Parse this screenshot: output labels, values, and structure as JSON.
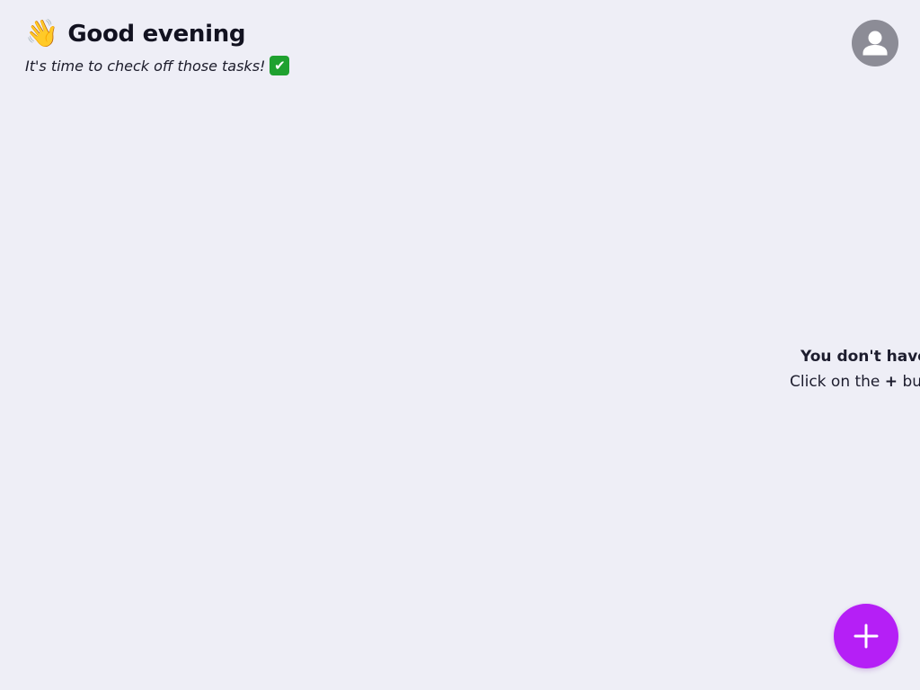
{
  "header": {
    "wave_emoji": "👋",
    "greeting": "Good evening",
    "subtitle": "It's time to check off those tasks!",
    "check_emoji": "✔"
  },
  "avatar": {
    "icon": "person-icon",
    "background": "#8c8c96"
  },
  "empty_state": {
    "title": "You don't have",
    "hint_prefix": "Click on the ",
    "hint_plus": "+",
    "hint_suffix": " bu"
  },
  "fab": {
    "icon": "plus-icon",
    "color": "#b51ff6"
  },
  "colors": {
    "background": "#eeeef6",
    "accent": "#b51ff6",
    "avatar": "#8c8c96",
    "check_green": "#1fa12f"
  }
}
